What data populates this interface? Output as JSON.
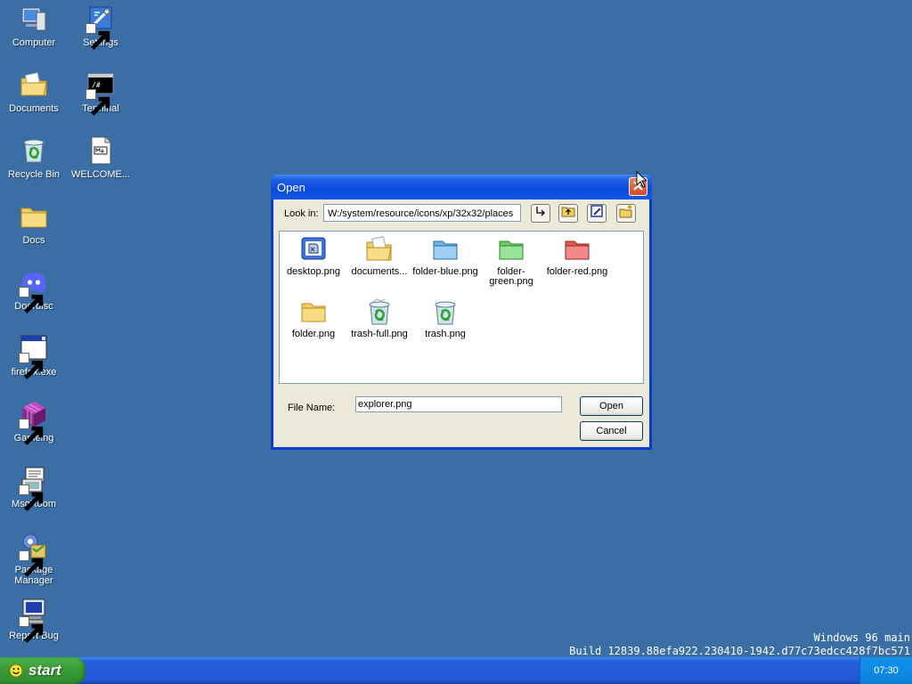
{
  "desktop": {
    "icons": [
      {
        "label": "Computer",
        "icon": "computer-icon"
      },
      {
        "label": "Settings",
        "icon": "settings-icon"
      },
      {
        "label": "Documents",
        "icon": "documents-icon"
      },
      {
        "label": "Terminal",
        "icon": "terminal-icon"
      },
      {
        "label": "Recycle Bin",
        "icon": "recycle-bin-icon"
      },
      {
        "label": "WELCOME...",
        "icon": "markdown-file-icon"
      },
      {
        "label": "Docs",
        "icon": "folder-icon"
      },
      {
        "label": "Doordisc",
        "icon": "doordisc-icon"
      },
      {
        "label": "firefox.exe",
        "icon": "window-app-icon"
      },
      {
        "label": "Gameing",
        "icon": "game-cube-icon"
      },
      {
        "label": "MsgRoom",
        "icon": "msgroom-icon"
      },
      {
        "label": "Package Manager",
        "icon": "package-manager-icon"
      },
      {
        "label": "Report Bug",
        "icon": "report-bug-icon"
      }
    ],
    "watermark_line1": "Windows 96 main",
    "watermark_line2": "Build 12839.88efa922.230410-1942.d77c73edcc428f7bc571"
  },
  "dialog": {
    "title": "Open",
    "look_in_label": "Look in:",
    "path": "W:/system/resource/icons/xp/32x32/places",
    "files": [
      {
        "name": "desktop.png",
        "icon": "desktop-file-icon"
      },
      {
        "name": "documents...",
        "icon": "documents-file-icon"
      },
      {
        "name": "folder-blue.png",
        "icon": "folder-blue-icon"
      },
      {
        "name": "folder-green.png",
        "icon": "folder-green-icon"
      },
      {
        "name": "folder-red.png",
        "icon": "folder-red-icon"
      },
      {
        "name": "folder.png",
        "icon": "folder-yellow-icon"
      },
      {
        "name": "trash-full.png",
        "icon": "trash-full-icon"
      },
      {
        "name": "trash.png",
        "icon": "trash-icon"
      }
    ],
    "file_name_label": "File Name:",
    "file_name_value": "explorer.png",
    "open_label": "Open",
    "cancel_label": "Cancel"
  },
  "taskbar": {
    "start_label": "start",
    "clock": "07:30"
  },
  "colors": {
    "desktop_bg": "#3a6ea5",
    "titlebar_blue": "#0b4adf",
    "start_green": "#3c9d37",
    "tray_blue": "#0f8ae6"
  }
}
